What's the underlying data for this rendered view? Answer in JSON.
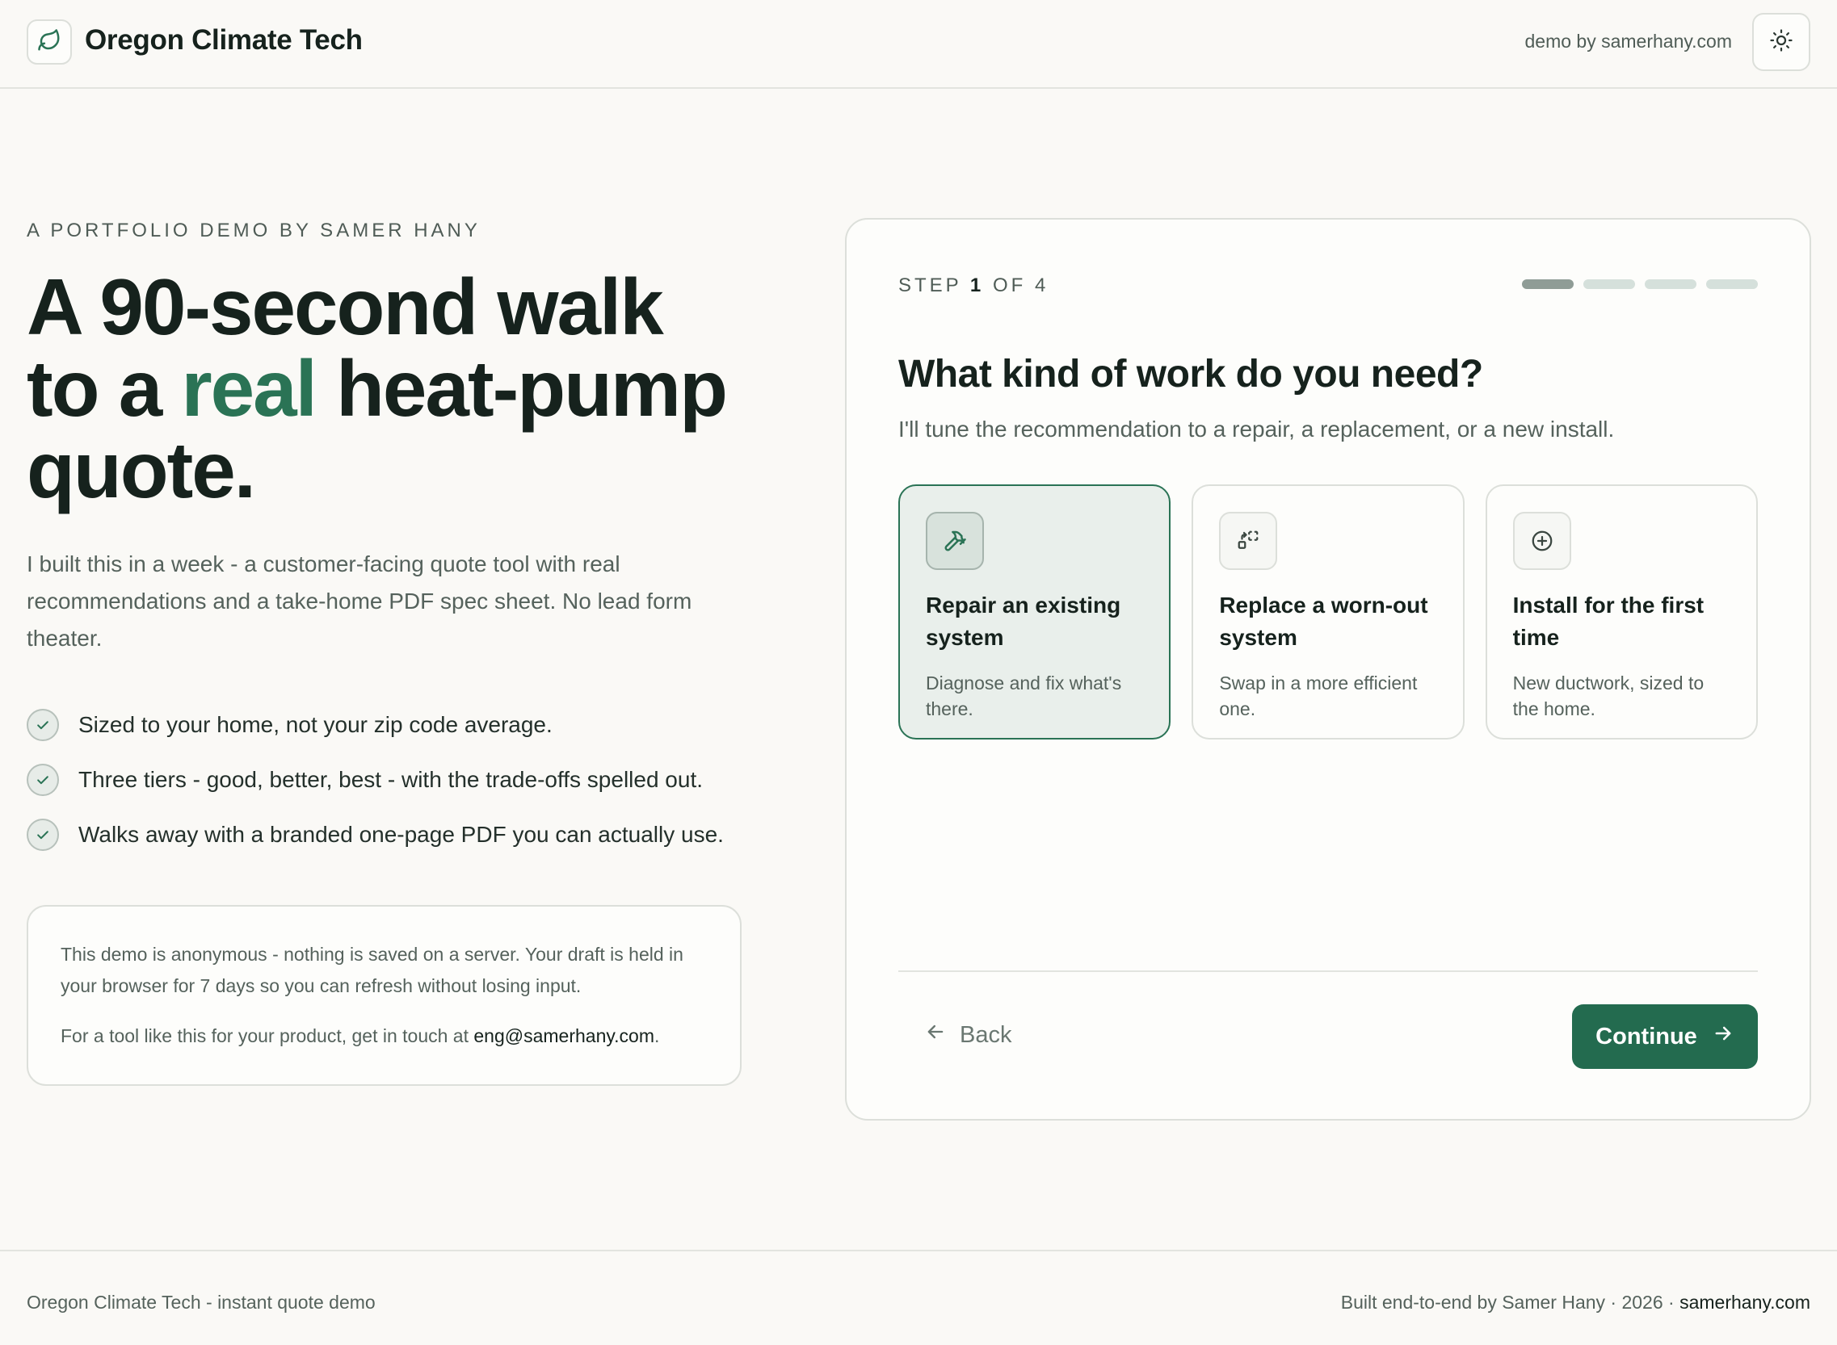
{
  "colors": {
    "accent": "#2a7355",
    "primary_button": "#236b4f",
    "background": "#faf9f6",
    "card": "#fdfdfb",
    "border": "#dcdfda"
  },
  "header": {
    "logo_icon": "leaf-icon",
    "brand": "Oregon Climate Tech",
    "link": "demo by samerhany.com",
    "theme_icon": "sun-icon"
  },
  "intro": {
    "eyebrow": "A PORTFOLIO DEMO BY SAMER HANY",
    "title_part1": "A 90-second walk to a ",
    "title_accent": "real",
    "title_part2": " heat-pump quote.",
    "subtitle": "I built this in a week - a customer-facing quote tool with real recommendations and a take-home PDF spec sheet. No lead form theater.",
    "features": [
      "Sized to your home, not your zip code average.",
      "Three tiers - good, better, best - with the trade-offs spelled out.",
      "Walks away with a branded one-page PDF you can actually use."
    ]
  },
  "note": {
    "privacy": "This demo is anonymous - nothing is saved on a server. Your draft is held in your browser for 7 days so you can refresh without losing input.",
    "contact_prefix": "For a tool like this for your product, get in touch at ",
    "email": "eng@samerhany.com",
    "contact_suffix": "."
  },
  "wizard": {
    "step_word": "STEP",
    "step_current": "1",
    "step_of": "OF",
    "step_total": "4",
    "current_step_index": 1,
    "total_steps": 4,
    "question": "What kind of work do you need?",
    "helper": "I'll tune the recommendation to a repair, a replacement, or a new install.",
    "options": [
      {
        "icon": "hammer-icon",
        "title": "Repair an existing system",
        "desc": "Diagnose and fix what's there.",
        "selected": true
      },
      {
        "icon": "swap-icon",
        "title": "Replace a worn-out system",
        "desc": "Swap in a more efficient one.",
        "selected": false
      },
      {
        "icon": "plus-circle-icon",
        "title": "Install for the first time",
        "desc": "New ductwork, sized to the home.",
        "selected": false
      }
    ],
    "back_label": "Back",
    "continue_label": "Continue"
  },
  "footer": {
    "left": "Oregon Climate Tech - instant quote demo",
    "right_prefix": "Built end-to-end by Samer Hany · 2026 · ",
    "right_site": "samerhany.com"
  }
}
